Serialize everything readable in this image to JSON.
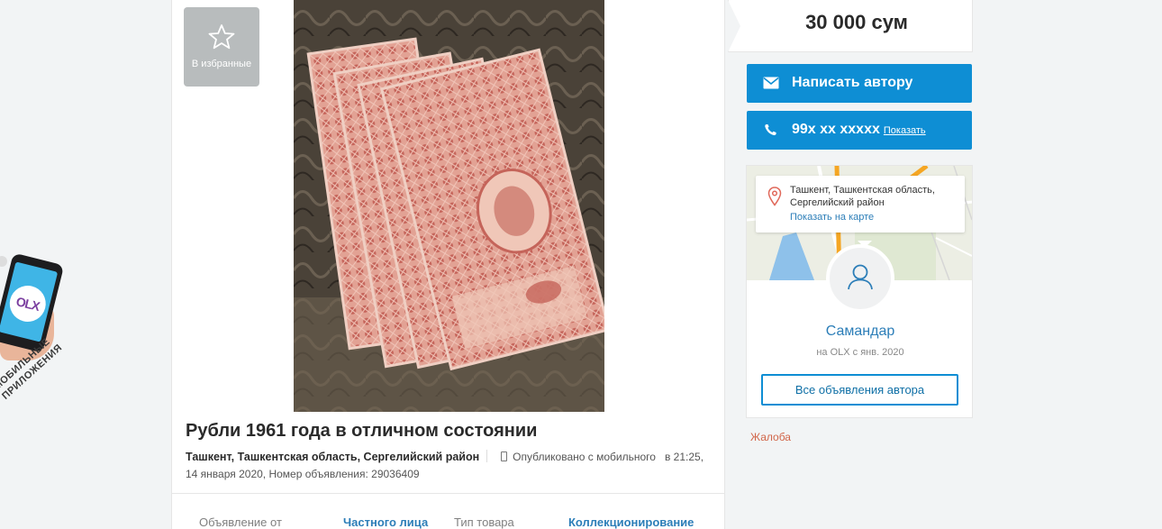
{
  "favorite": {
    "label": "В избранные"
  },
  "promo": {
    "text": "Мобильные приложения",
    "logo": "OLX"
  },
  "listing": {
    "title": "Рубли 1961 года в отличном состоянии",
    "location": "Ташкент, Ташкентская область, Сергелийский район",
    "published": "Опубликовано с мобильного",
    "time": "в 21:25, 14 января 2020, Номер объявления: 29036409"
  },
  "details": [
    {
      "label": "Объявление от",
      "value": "Частного лица"
    },
    {
      "label": "Тип товара",
      "value": "Коллекционирование"
    }
  ],
  "sidebar": {
    "price": "30 000 сум",
    "write_button": "Написать автору",
    "phone": "99x xx xxxxx",
    "phone_show": "Показать",
    "address": "Ташкент, Ташкентская область, Сергелийский район",
    "show_on_map": "Показать на карте",
    "user_name": "Самандар",
    "user_since": "на OLX с янв. 2020",
    "all_ads": "Все объявления автора",
    "complaint": "Жалоба"
  },
  "colors": {
    "accent": "#0e8ed4",
    "link": "#2c7eb8",
    "complaint": "#d1664a",
    "map_road": "#f5a623",
    "map_water": "#8ec1ea"
  },
  "icons": [
    "star-icon",
    "envelope-icon",
    "phone-icon",
    "map-pin-icon",
    "user-icon",
    "mobile-icon"
  ]
}
